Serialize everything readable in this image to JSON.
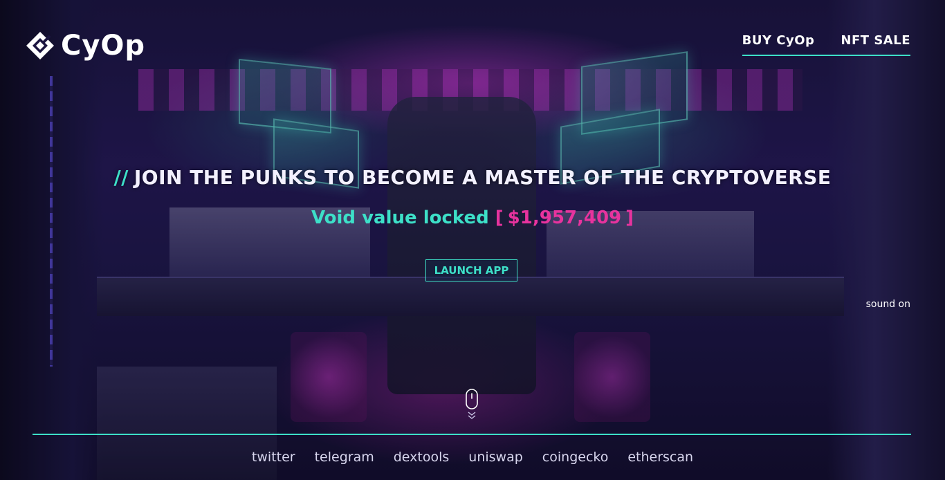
{
  "brand": {
    "name": "CyOp",
    "logo_icon": "cyop-diamond-logo-icon"
  },
  "nav": {
    "items": [
      {
        "label": "BUY CyOp"
      },
      {
        "label": "NFT SALE"
      }
    ]
  },
  "hero": {
    "headline_prefix": "//",
    "headline": "JOIN THE PUNKS TO BECOME A MASTER OF THE CRYPTOVERSE",
    "tvl_label": "Void value locked",
    "tvl_open": "[",
    "tvl_value": "$1,957,409",
    "tvl_close": "]",
    "launch_label": "LAUNCH APP"
  },
  "sound": {
    "label": "sound on"
  },
  "scroll": {
    "icon": "mouse-scroll-down-icon"
  },
  "footer": {
    "links": [
      {
        "label": "twitter"
      },
      {
        "label": "telegram"
      },
      {
        "label": "dextools"
      },
      {
        "label": "uniswap"
      },
      {
        "label": "coingecko"
      },
      {
        "label": "etherscan"
      }
    ]
  },
  "colors": {
    "accent_teal": "#3de0c8",
    "accent_pink": "#e8339e",
    "text_white": "#ffffff"
  }
}
